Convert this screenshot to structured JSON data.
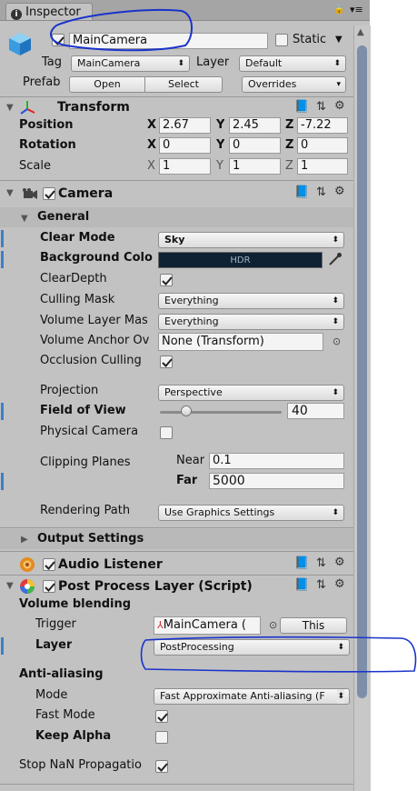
{
  "tab": {
    "icon": "info-icon",
    "title": "Inspector"
  },
  "object": {
    "name": "MainCamera",
    "active": true,
    "static_label": "Static",
    "static": false,
    "tag_label": "Tag",
    "tag_value": "MainCamera",
    "layer_label": "Layer",
    "layer_value": "Default",
    "prefab_label": "Prefab",
    "open_label": "Open",
    "select_label": "Select",
    "overrides_label": "Overrides"
  },
  "transform": {
    "title": "Transform",
    "position_label": "Position",
    "rotation_label": "Rotation",
    "scale_label": "Scale",
    "position": {
      "x": "2.67",
      "y": "2.45",
      "z": "-7.22"
    },
    "rotation": {
      "x": "0",
      "y": "0",
      "z": "0"
    },
    "scale": {
      "x": "1",
      "y": "1",
      "z": "1"
    },
    "axis_x": "X",
    "axis_y": "Y",
    "axis_z": "Z"
  },
  "camera": {
    "title": "Camera",
    "general_label": "General",
    "clear_mode_label": "Clear Mode",
    "clear_mode_value": "Sky",
    "background_color_label": "Background Colo",
    "hdr_label": "HDR",
    "clear_depth_label": "ClearDepth",
    "culling_mask_label": "Culling Mask",
    "culling_mask_value": "Everything",
    "volume_layer_mask_label": "Volume Layer Mas",
    "volume_layer_mask_value": "Everything",
    "volume_anchor_label": "Volume Anchor Ov",
    "volume_anchor_value": "None (Transform)",
    "occlusion_culling_label": "Occlusion Culling",
    "projection_label": "Projection",
    "projection_value": "Perspective",
    "fov_label": "Field of View",
    "fov_value": "40",
    "fov_fraction": 0.22,
    "physical_camera_label": "Physical Camera",
    "clipping_planes_label": "Clipping Planes",
    "near_label": "Near",
    "near_value": "0.1",
    "far_label": "Far",
    "far_value": "5000",
    "rendering_path_label": "Rendering Path",
    "rendering_path_value": "Use Graphics Settings",
    "output_settings_label": "Output Settings"
  },
  "audio_listener": {
    "title": "Audio Listener"
  },
  "post_process": {
    "title": "Post Process Layer (Script)",
    "volume_blending_label": "Volume blending",
    "trigger_label": "Trigger",
    "trigger_value": "MainCamera (",
    "this_label": "This",
    "layer_label": "Layer",
    "layer_value": "PostProcessing",
    "anti_aliasing_label": "Anti-aliasing",
    "mode_label": "Mode",
    "mode_value": "Fast Approximate Anti-aliasing (F",
    "fast_mode_label": "Fast Mode",
    "keep_alpha_label": "Keep Alpha",
    "stop_nan_label": "Stop NaN Propagatio"
  },
  "colors": {
    "panel_bg": "#c2c2c2",
    "accent_blue": "#3d7ec9",
    "hdr_swatch": "#0e2233",
    "annotation_ink": "#1a33cc"
  }
}
